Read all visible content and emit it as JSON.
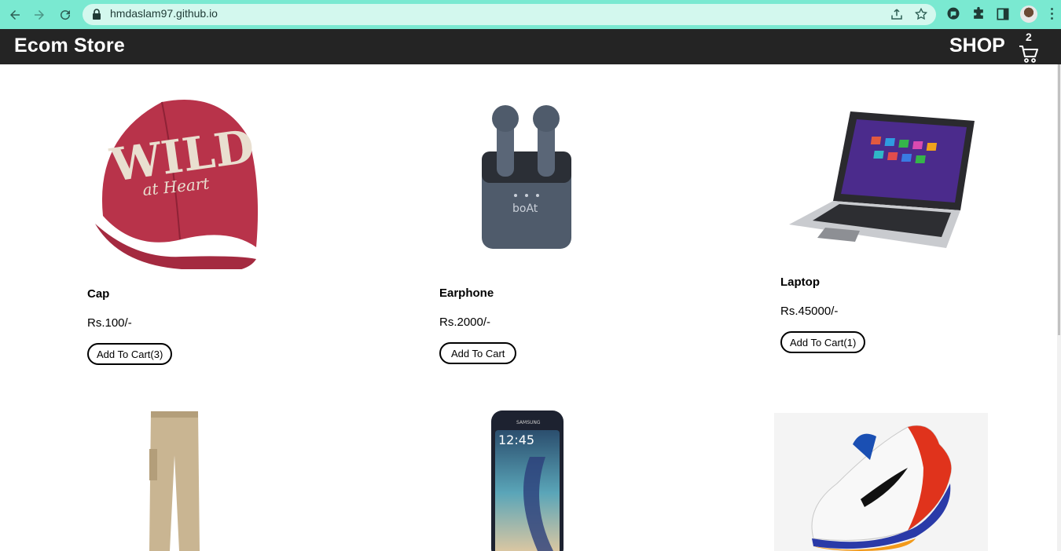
{
  "browser": {
    "url": "hmdaslam97.github.io"
  },
  "navbar": {
    "brand": "Ecom Store",
    "shop_label": "SHOP",
    "cart_count": "2"
  },
  "products": [
    {
      "name": "Cap",
      "price": "Rs.100/-",
      "button": "Add To Cart(3)"
    },
    {
      "name": "Earphone",
      "price": "Rs.2000/-",
      "button": "Add To Cart"
    },
    {
      "name": "Laptop",
      "price": "Rs.45000/-",
      "button": "Add To Cart(1)"
    },
    {
      "name": "",
      "price": "",
      "button": ""
    },
    {
      "name": "",
      "price": "",
      "button": ""
    },
    {
      "name": "",
      "price": "",
      "button": ""
    }
  ],
  "icons": {
    "back": "arrow-left-icon",
    "forward": "arrow-right-icon",
    "reload": "reload-icon",
    "lock": "lock-icon",
    "share": "share-icon",
    "bookmark": "star-icon",
    "extension": "puzzle-icon",
    "sidepanel": "side-panel-icon",
    "cart": "cart-icon"
  },
  "colors": {
    "chrome_bar": "#7ae9d1",
    "navbar": "#242424",
    "cap_red": "#b8334a",
    "earphone_case": "#4f5b6b"
  }
}
